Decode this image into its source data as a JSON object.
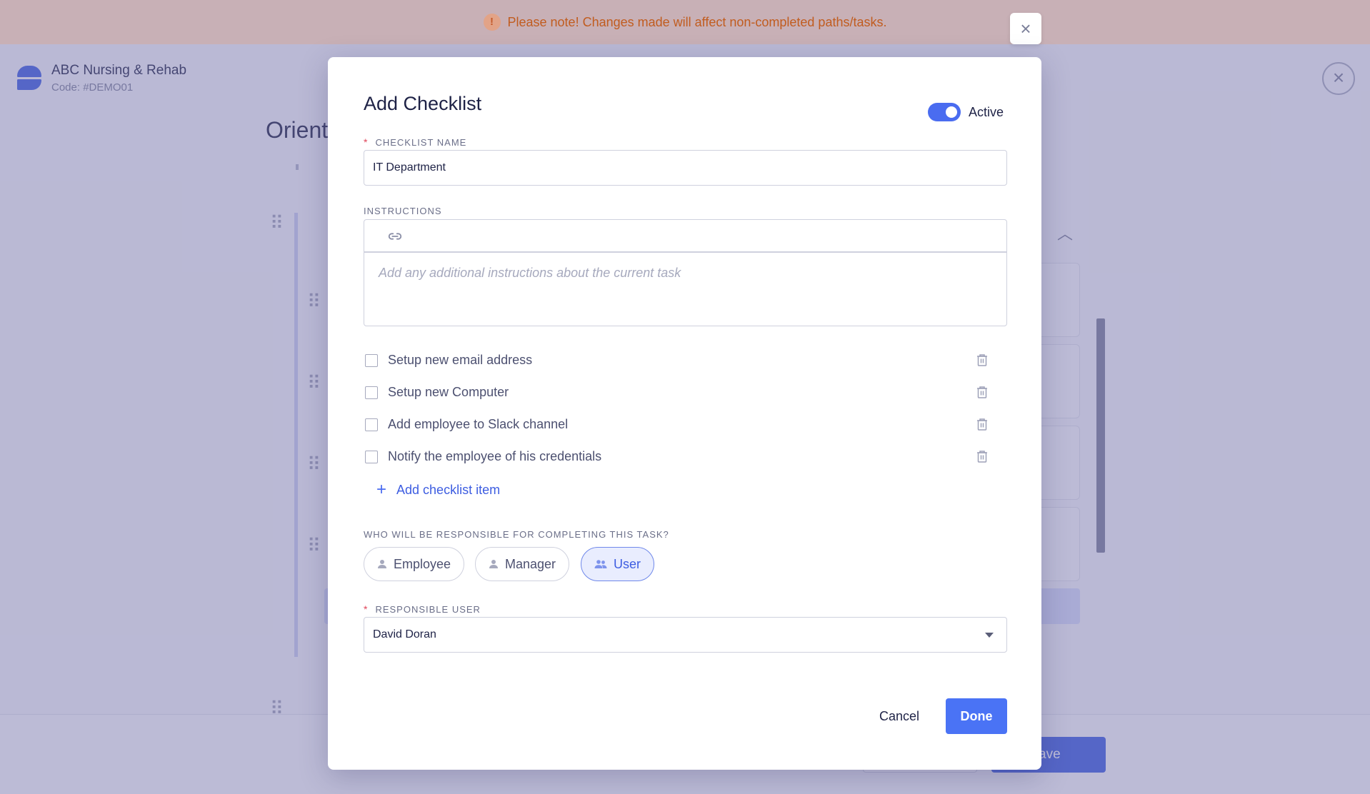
{
  "notice": {
    "icon": "!",
    "text": "Please note! Changes made will affect non-completed paths/tasks."
  },
  "background": {
    "org_name": "ABC Nursing & Rehab",
    "org_code": "Code: #DEMO01",
    "page_title": "Orient",
    "save_label": "ave"
  },
  "modal": {
    "title": "Add Checklist",
    "active_label": "Active",
    "active": true,
    "name_label": "CHECKLIST NAME",
    "name_value": "IT Department",
    "instructions_label": "INSTRUCTIONS",
    "instructions_placeholder": "Add any additional instructions about the current task",
    "items": [
      {
        "text": "Setup new email address",
        "checked": false
      },
      {
        "text": "Setup new Computer",
        "checked": false
      },
      {
        "text": "Add employee to Slack channel",
        "checked": false
      },
      {
        "text": "Notify the employee of his credentials",
        "checked": false
      }
    ],
    "add_item_label": "Add checklist item",
    "responsible_question": "WHO WILL BE RESPONSIBLE FOR COMPLETING THIS TASK?",
    "roles": [
      {
        "label": "Employee",
        "selected": false
      },
      {
        "label": "Manager",
        "selected": false
      },
      {
        "label": "User",
        "selected": true
      }
    ],
    "responsible_user_label": "RESPONSIBLE USER",
    "responsible_user_value": "David Doran",
    "cancel_label": "Cancel",
    "done_label": "Done"
  },
  "colors": {
    "accent": "#4a6cf0",
    "notice_text": "#c15c1f",
    "required": "#e0455a"
  }
}
